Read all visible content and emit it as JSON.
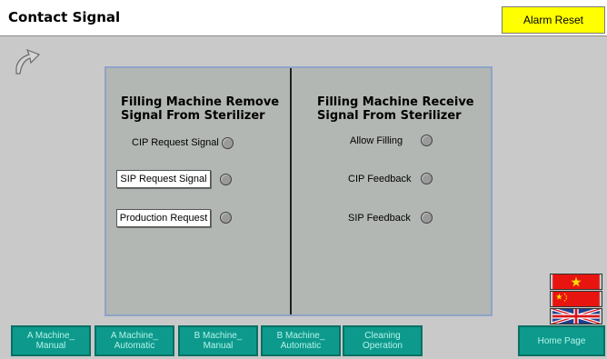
{
  "header": {
    "title": "Contact Signal",
    "alarm_reset": "Alarm Reset"
  },
  "left_section": {
    "title_line1": "Filling Machine Remove",
    "title_line2": "Signal From Sterilizer",
    "items": [
      {
        "label": "CIP Request Signal"
      },
      {
        "label": "SIP Request Signal"
      },
      {
        "label": "Production Request"
      }
    ]
  },
  "right_section": {
    "title_line1": "Filling Machine Receive",
    "title_line2": "Signal From Sterilizer",
    "items": [
      {
        "label": "Allow Filling"
      },
      {
        "label": "CIP Feedback"
      },
      {
        "label": "SIP Feedback"
      }
    ]
  },
  "nav": {
    "buttons": [
      {
        "line1": "A Machine_",
        "line2": "Manual"
      },
      {
        "line1": "A Machine_",
        "line2": "Automatic"
      },
      {
        "line1": "B Machine_",
        "line2": "Manual"
      },
      {
        "line1": "B Machine_",
        "line2": "Automatic"
      },
      {
        "line1": "Cleaning",
        "line2": "Operation"
      }
    ],
    "home": "Home Page"
  },
  "languages": [
    "vietnam-flag-icon",
    "china-flag-icon",
    "uk-flag-icon"
  ],
  "colors": {
    "alarm": "#ffff00",
    "nav": "#0d9a8c",
    "panel": "#b3b7b3",
    "panel_border": "#8ea3c8"
  }
}
